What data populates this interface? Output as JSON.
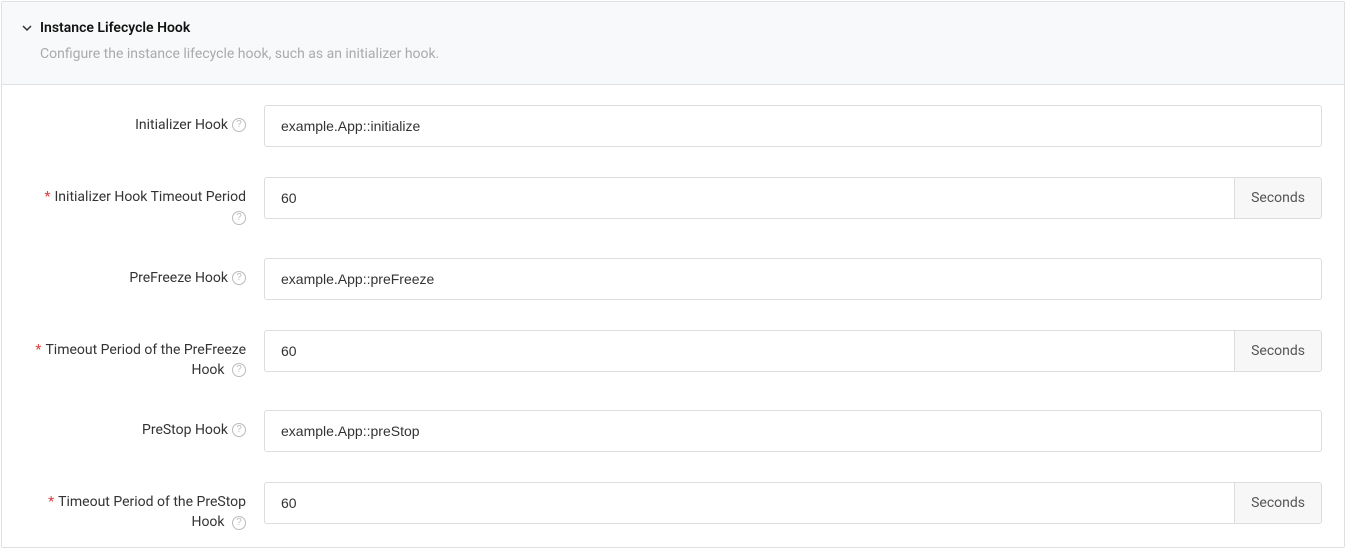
{
  "panel": {
    "title": "Instance Lifecycle Hook",
    "desc": "Configure the instance lifecycle hook, such as an initializer hook."
  },
  "form": {
    "initializer": {
      "label": "Initializer Hook",
      "value": "example.App::initialize"
    },
    "initializer_timeout": {
      "label": "Initializer Hook Timeout Period",
      "value": "60",
      "unit": "Seconds"
    },
    "prefreeze": {
      "label": "PreFreeze Hook",
      "value": "example.App::preFreeze"
    },
    "prefreeze_timeout": {
      "label": "Timeout Period of the PreFreeze Hook",
      "value": "60",
      "unit": "Seconds"
    },
    "prestop": {
      "label": "PreStop Hook",
      "value": "example.App::preStop"
    },
    "prestop_timeout": {
      "label": "Timeout Period of the PreStop Hook",
      "value": "60",
      "unit": "Seconds"
    }
  }
}
